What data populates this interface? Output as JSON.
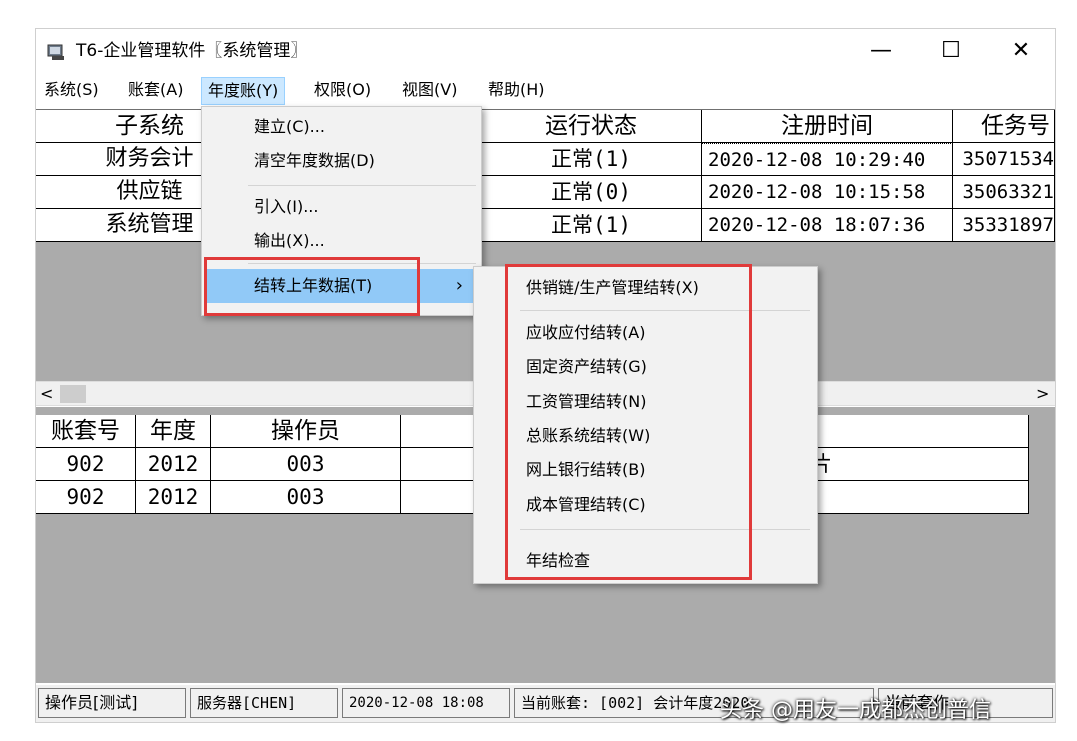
{
  "window": {
    "title": "T6-企业管理软件〖系统管理〗",
    "minimize": "—",
    "maximize": "☐",
    "close": "✕",
    "icon": "app-icon"
  },
  "menubar": [
    "系统(S)",
    "账套(A)",
    "年度账(Y)",
    "权限(O)",
    "视图(V)",
    "帮助(H)"
  ],
  "upper_table": {
    "headers": [
      "子系统",
      "运行状态",
      "注册时间",
      "任务号"
    ],
    "rows": [
      [
        "财务会计",
        "正常(1)",
        "2020-12-08 10:29:40",
        "35071534"
      ],
      [
        "供应链",
        "正常(0)",
        "2020-12-08 10:15:58",
        "35063321"
      ],
      [
        "系统管理",
        "正常(1)",
        "2020-12-08 18:07:36",
        "35331897"
      ]
    ]
  },
  "scroll": {
    "left": "<",
    "right": ">"
  },
  "lower_table": {
    "headers": [
      "账套号",
      "年度",
      "操作员"
    ],
    "rows": [
      [
        "902",
        "2012",
        "003",
        "片"
      ],
      [
        "902",
        "2012",
        "003",
        ""
      ]
    ]
  },
  "annual_menu": {
    "items": [
      "建立(C)...",
      "清空年度数据(D)",
      "引入(I)...",
      "输出(X)...",
      "结转上年数据(T)"
    ],
    "submenu_arrow": "›"
  },
  "carryover_submenu": {
    "items": [
      "供销链/生产管理结转(X)",
      "应收应付结转(A)",
      "固定资产结转(G)",
      "工资管理结转(N)",
      "总账系统结转(W)",
      "网上银行结转(B)",
      "成本管理结转(C)",
      "年结检查"
    ]
  },
  "statusbar": {
    "operator": "操作员[测试]",
    "server": "服务器[CHEN]",
    "datetime": "2020-12-08 18:08",
    "current_account": "当前账套: [002] 会计年度2020",
    "extra": "当前套作"
  },
  "watermark": "头条 @用友一成都杰创普信",
  "colors": {
    "highlight_border": "#e03a3a",
    "menu_selected": "#91c9f7",
    "menubar_active": "#cce8ff",
    "grid_background": "#ababab"
  }
}
